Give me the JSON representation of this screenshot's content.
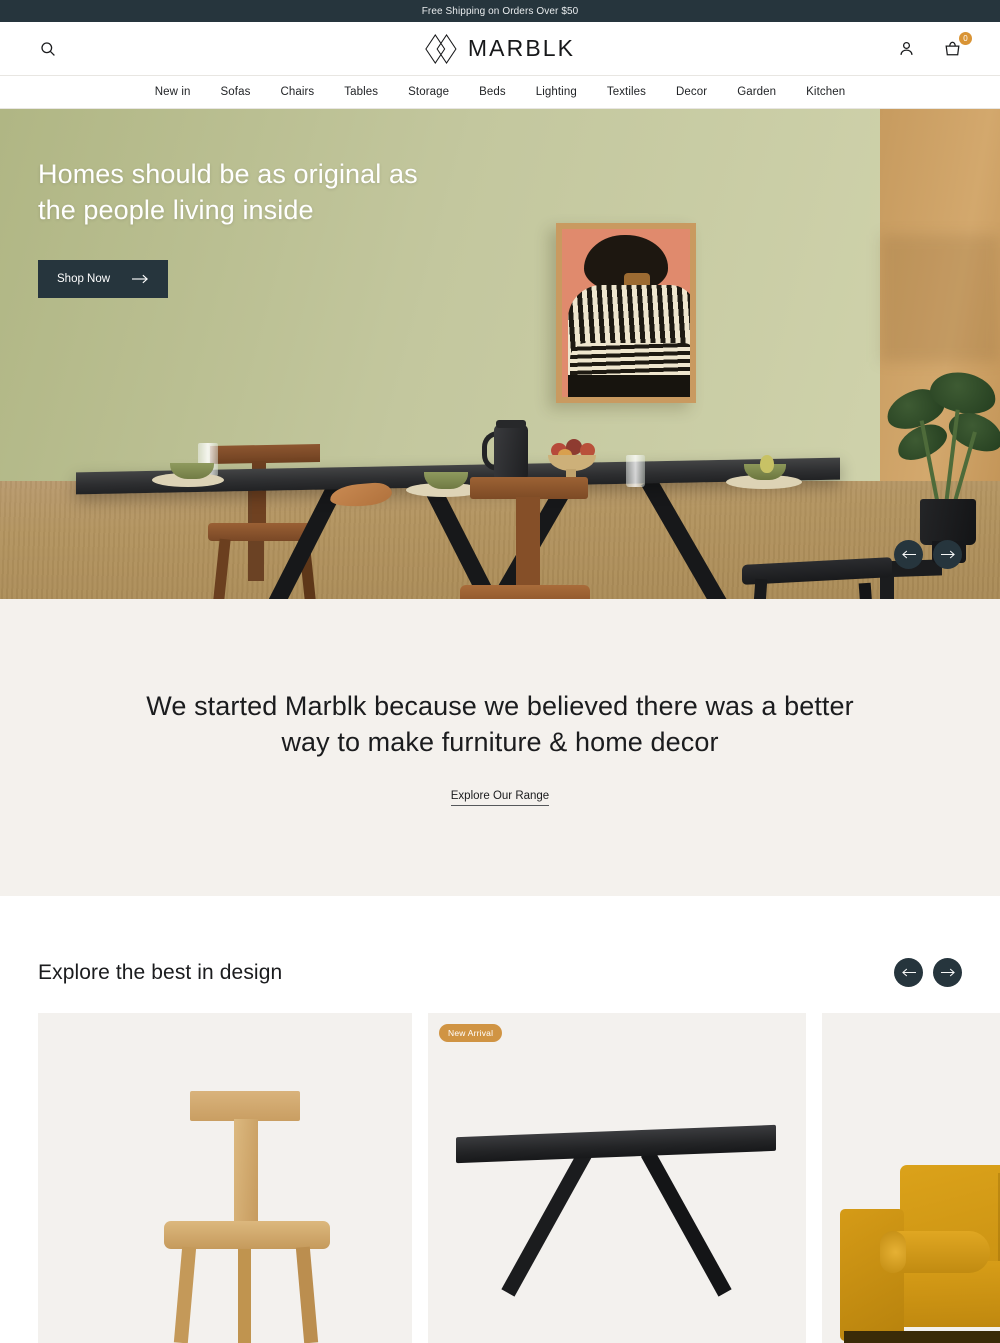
{
  "announcement": {
    "text": "Free Shipping on Orders Over $50",
    "bg_color": "#26353d"
  },
  "header": {
    "search_icon": "search-icon",
    "logo_text": "MARBLK",
    "logo_mark": "diamond-logo-icon",
    "account_icon": "user-account-icon",
    "cart_icon": "shopping-bag-icon",
    "cart_count": "0",
    "cart_badge_color": "#d99435"
  },
  "nav": {
    "items": [
      {
        "label": "New in"
      },
      {
        "label": "Sofas"
      },
      {
        "label": "Chairs"
      },
      {
        "label": "Tables"
      },
      {
        "label": "Storage"
      },
      {
        "label": "Beds"
      },
      {
        "label": "Lighting"
      },
      {
        "label": "Textiles"
      },
      {
        "label": "Decor"
      },
      {
        "label": "Garden"
      },
      {
        "label": "Kitchen"
      }
    ]
  },
  "hero": {
    "heading": "Homes should be as original as the people living inside",
    "cta_label": "Shop Now",
    "cta_icon": "arrow-right-icon",
    "prev_icon": "arrow-left-icon",
    "next_icon": "arrow-right-icon",
    "scene_description": "Dining room with black dining table, wooden chairs, framed portrait artwork and monstera plant"
  },
  "mission": {
    "heading": "We started Marblk because we believed there was a better way to make furniture & home decor",
    "link_label": "Explore Our Range",
    "bg_color": "#f4f1ed"
  },
  "products": {
    "section_title": "Explore the best in design",
    "prev_icon": "arrow-left-icon",
    "next_icon": "arrow-right-icon",
    "cards": [
      {
        "image_alt": "Light oak T-back dining chair",
        "badge": ""
      },
      {
        "image_alt": "Black wooden dining table with crossed legs",
        "badge": "New Arrival"
      },
      {
        "image_alt": "Mustard yellow velvet sofa with bolster cushion",
        "badge": ""
      }
    ]
  },
  "colors": {
    "dark": "#26353d",
    "accent_orange": "#d09443",
    "cream": "#f4f1ed",
    "card_bg": "#f3f1ee"
  }
}
